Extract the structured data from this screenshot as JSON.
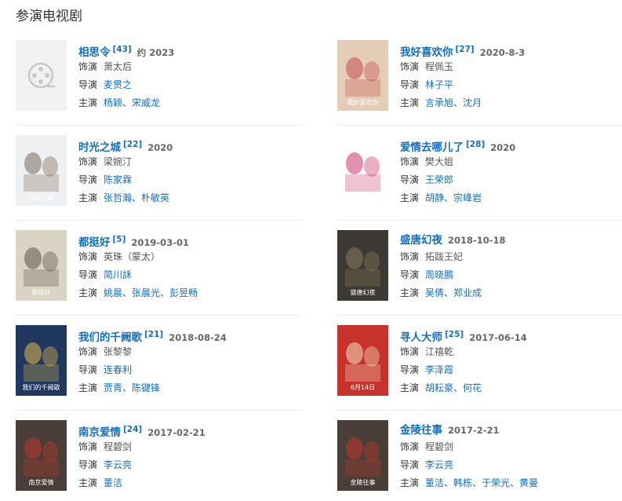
{
  "section_title": "参演电视剧",
  "labels": {
    "role": "饰演",
    "director": "导演",
    "stars": "主演",
    "sep": "、"
  },
  "items": [
    {
      "title": "相思令",
      "cite": "[43]",
      "year": "约 2023",
      "role": "萧太后",
      "director": "麦贯之",
      "stars": [
        "杨颖",
        "宋威龙"
      ],
      "poster": {
        "kind": "placeholder",
        "icon": "film-reel-icon"
      }
    },
    {
      "title": "我好喜欢你",
      "cite": "[27]",
      "year": "2020-8-3",
      "role": "程佩玉",
      "director": "林子平",
      "stars": [
        "言承旭",
        "沈月"
      ],
      "poster": {
        "kind": "image",
        "caption": "我好喜欢你",
        "bg": "#e4cdb7",
        "accent": "#c44d4a"
      }
    },
    {
      "title": "时光之城",
      "cite": "[22]",
      "year": "2020",
      "role": "梁婉汀",
      "director": "陈家霖",
      "stars": [
        "张哲瀚",
        "朴敏英"
      ],
      "poster": {
        "kind": "image",
        "caption": "时光之城",
        "bg": "#eef0f2",
        "accent": "#7a6a5c"
      }
    },
    {
      "title": "爱情去哪儿了",
      "cite": "[28]",
      "year": "2020",
      "role": "樊大姐",
      "director": "王荣郎",
      "stars": [
        "胡静",
        "宗峰岩"
      ],
      "poster": {
        "kind": "image",
        "caption": "爱情去哪儿了",
        "bg": "#ffffff",
        "accent": "#c9376b"
      }
    },
    {
      "title": "都挺好",
      "cite": "[5]",
      "year": "2019-03-01",
      "role": "英珠（蒙太）",
      "director": "简川訸",
      "stars": [
        "姚晨",
        "张晨光",
        "彭昱畅"
      ],
      "poster": {
        "kind": "image",
        "caption": "都挺好",
        "bg": "#d9d4c4",
        "accent": "#5a5347"
      }
    },
    {
      "title": "盛唐幻夜",
      "cite": "",
      "year": "2018-10-18",
      "role": "拓跋王妃",
      "director": "周晓鹏",
      "stars": [
        "吴倩",
        "郑业成"
      ],
      "poster": {
        "kind": "image",
        "caption": "盛唐幻夜",
        "bg": "#3d3a36",
        "accent": "#8a7b5a"
      }
    },
    {
      "title": "我们的千阙歌",
      "cite": "[21]",
      "year": "2018-08-24",
      "role": "张黎黎",
      "director": "连春利",
      "stars": [
        "贾青",
        "陈键锋"
      ],
      "poster": {
        "kind": "image",
        "caption": "我们的千阙歌",
        "bg": "#20375f",
        "accent": "#e0b94a"
      }
    },
    {
      "title": "寻人大师",
      "cite": "[25]",
      "year": "2017-06-14",
      "role": "江禧乾",
      "director": "李泽霞",
      "stars": [
        "胡耘豪",
        "何花"
      ],
      "poster": {
        "kind": "image",
        "caption": "6月14日",
        "bg": "#c8322c",
        "accent": "#f3e3c2"
      }
    },
    {
      "title": "南京爱情",
      "cite": "[24]",
      "year": "2017-02-21",
      "role": "程碧剑",
      "director": "李云亮",
      "stars": [
        "董洁"
      ],
      "poster": {
        "kind": "image",
        "caption": "南京爱情",
        "bg": "#4a3f38",
        "accent": "#c0352b"
      }
    },
    {
      "title": "金陵往事",
      "cite": "",
      "year": "2017-2-21",
      "role": "程碧剑",
      "director": "李云亮",
      "stars": [
        "董洁",
        "韩栋",
        "于荣光",
        "黄曼"
      ],
      "poster": {
        "kind": "image",
        "caption": "金陵往事",
        "bg": "#4a3f38",
        "accent": "#c0352b"
      }
    }
  ]
}
